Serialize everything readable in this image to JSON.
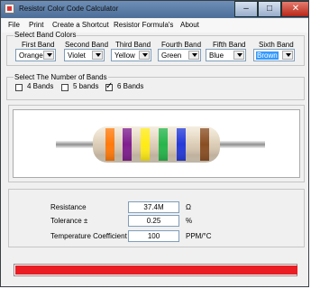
{
  "window": {
    "title": "Resistor Color Code Calculator",
    "controls": {
      "minimize": "–",
      "maximize": "□",
      "close": "✕"
    }
  },
  "menu": [
    "File",
    "Print",
    "Create a Shortcut",
    "Resistor Formula's",
    "About"
  ],
  "band_colors_group": {
    "title": "Select Band Colors",
    "bands": [
      {
        "label": "First Band",
        "value": "Orange",
        "color": "#ff7a0a"
      },
      {
        "label": "Second Band",
        "value": "Violet",
        "color": "#7f1d8f"
      },
      {
        "label": "Third Band",
        "value": "Yellow",
        "color": "#ffeb14"
      },
      {
        "label": "Fourth Band",
        "value": "Green",
        "color": "#25b54a"
      },
      {
        "label": "Fifth Band",
        "value": "Blue",
        "color": "#2439d9"
      },
      {
        "label": "Sixth Band",
        "value": "Brown",
        "color": "#8a4e22"
      }
    ]
  },
  "number_of_bands": {
    "title": "Select The Number of Bands",
    "options": [
      {
        "label": "4 Bands",
        "checked": false
      },
      {
        "label": "5 bands",
        "checked": false
      },
      {
        "label": "6 Bands",
        "checked": true
      }
    ]
  },
  "resistor_icon": "resistor-image",
  "results": {
    "resistance_label": "Resistance",
    "resistance_value": "37.4M",
    "resistance_unit": "Ω",
    "tolerance_label": "Tolerance ±",
    "tolerance_value": "0.25",
    "tolerance_unit": "%",
    "temp_label": "Temperature Coefficient",
    "temp_value": "100",
    "temp_unit": "PPM/°C"
  },
  "status_bar": {
    "progress": 1.0,
    "color": "#ea1c24"
  }
}
